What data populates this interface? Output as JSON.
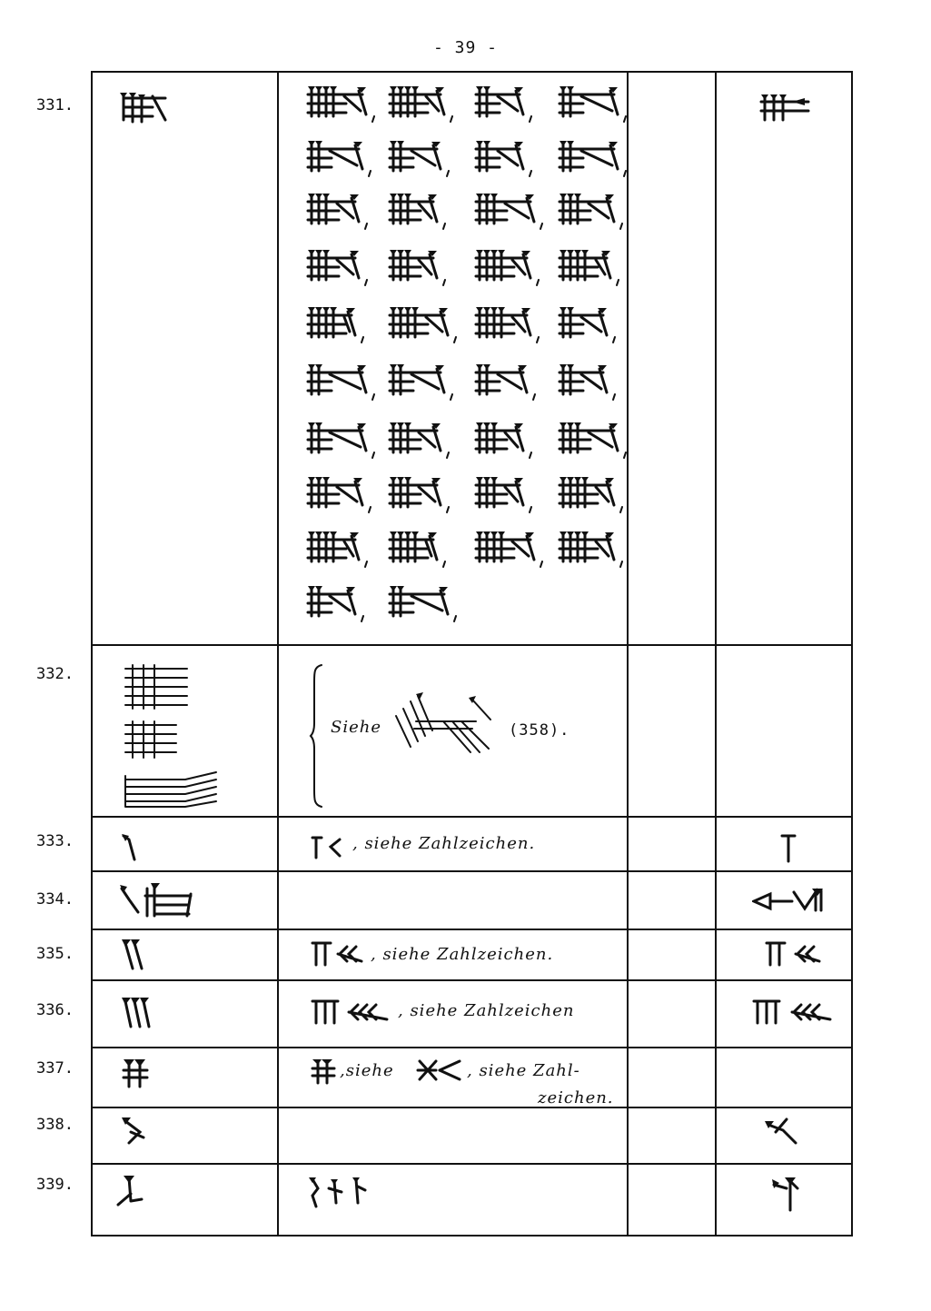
{
  "page": {
    "number": "- 39 -"
  },
  "rows": [
    {
      "number": "331.",
      "variants_count": 38
    },
    {
      "number": "332.",
      "note": "Siehe",
      "ref": "(358)."
    },
    {
      "number": "333.",
      "note": ", siehe Zahlzeichen."
    },
    {
      "number": "334."
    },
    {
      "number": "335.",
      "note": ", siehe Zahlzeichen."
    },
    {
      "number": "336.",
      "note": ", siehe Zahlzeichen"
    },
    {
      "number": "337.",
      "note1": ",siehe",
      "note2": ", siehe Zahl-",
      "note3": "zeichen."
    },
    {
      "number": "338."
    },
    {
      "number": "339."
    }
  ],
  "icons": {
    "main_sign": "cuneiform-sign-icon",
    "variant": "cuneiform-variant-icon",
    "bracket": "curly-brace-icon"
  }
}
